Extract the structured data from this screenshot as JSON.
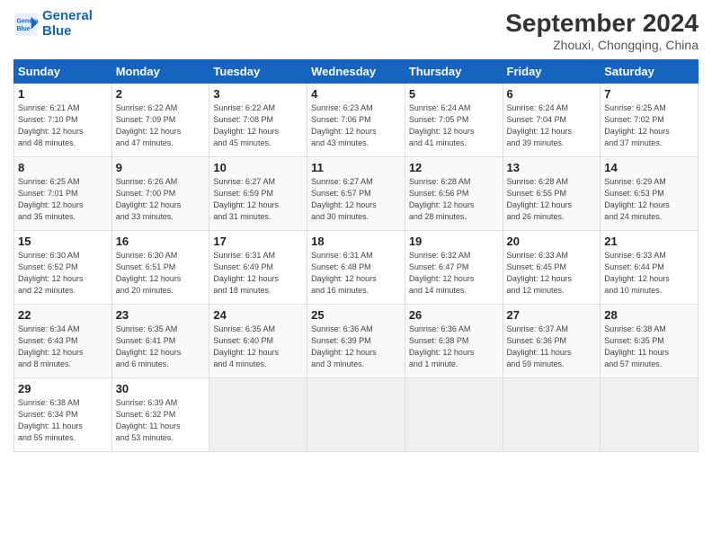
{
  "header": {
    "logo_line1": "General",
    "logo_line2": "Blue",
    "month_title": "September 2024",
    "location": "Zhouxi, Chongqing, China"
  },
  "weekdays": [
    "Sunday",
    "Monday",
    "Tuesday",
    "Wednesday",
    "Thursday",
    "Friday",
    "Saturday"
  ],
  "weeks": [
    [
      {
        "day": "1",
        "info": "Sunrise: 6:21 AM\nSunset: 7:10 PM\nDaylight: 12 hours\nand 48 minutes."
      },
      {
        "day": "2",
        "info": "Sunrise: 6:22 AM\nSunset: 7:09 PM\nDaylight: 12 hours\nand 47 minutes."
      },
      {
        "day": "3",
        "info": "Sunrise: 6:22 AM\nSunset: 7:08 PM\nDaylight: 12 hours\nand 45 minutes."
      },
      {
        "day": "4",
        "info": "Sunrise: 6:23 AM\nSunset: 7:06 PM\nDaylight: 12 hours\nand 43 minutes."
      },
      {
        "day": "5",
        "info": "Sunrise: 6:24 AM\nSunset: 7:05 PM\nDaylight: 12 hours\nand 41 minutes."
      },
      {
        "day": "6",
        "info": "Sunrise: 6:24 AM\nSunset: 7:04 PM\nDaylight: 12 hours\nand 39 minutes."
      },
      {
        "day": "7",
        "info": "Sunrise: 6:25 AM\nSunset: 7:02 PM\nDaylight: 12 hours\nand 37 minutes."
      }
    ],
    [
      {
        "day": "8",
        "info": "Sunrise: 6:25 AM\nSunset: 7:01 PM\nDaylight: 12 hours\nand 35 minutes."
      },
      {
        "day": "9",
        "info": "Sunrise: 6:26 AM\nSunset: 7:00 PM\nDaylight: 12 hours\nand 33 minutes."
      },
      {
        "day": "10",
        "info": "Sunrise: 6:27 AM\nSunset: 6:59 PM\nDaylight: 12 hours\nand 31 minutes."
      },
      {
        "day": "11",
        "info": "Sunrise: 6:27 AM\nSunset: 6:57 PM\nDaylight: 12 hours\nand 30 minutes."
      },
      {
        "day": "12",
        "info": "Sunrise: 6:28 AM\nSunset: 6:56 PM\nDaylight: 12 hours\nand 28 minutes."
      },
      {
        "day": "13",
        "info": "Sunrise: 6:28 AM\nSunset: 6:55 PM\nDaylight: 12 hours\nand 26 minutes."
      },
      {
        "day": "14",
        "info": "Sunrise: 6:29 AM\nSunset: 6:53 PM\nDaylight: 12 hours\nand 24 minutes."
      }
    ],
    [
      {
        "day": "15",
        "info": "Sunrise: 6:30 AM\nSunset: 6:52 PM\nDaylight: 12 hours\nand 22 minutes."
      },
      {
        "day": "16",
        "info": "Sunrise: 6:30 AM\nSunset: 6:51 PM\nDaylight: 12 hours\nand 20 minutes."
      },
      {
        "day": "17",
        "info": "Sunrise: 6:31 AM\nSunset: 6:49 PM\nDaylight: 12 hours\nand 18 minutes."
      },
      {
        "day": "18",
        "info": "Sunrise: 6:31 AM\nSunset: 6:48 PM\nDaylight: 12 hours\nand 16 minutes."
      },
      {
        "day": "19",
        "info": "Sunrise: 6:32 AM\nSunset: 6:47 PM\nDaylight: 12 hours\nand 14 minutes."
      },
      {
        "day": "20",
        "info": "Sunrise: 6:33 AM\nSunset: 6:45 PM\nDaylight: 12 hours\nand 12 minutes."
      },
      {
        "day": "21",
        "info": "Sunrise: 6:33 AM\nSunset: 6:44 PM\nDaylight: 12 hours\nand 10 minutes."
      }
    ],
    [
      {
        "day": "22",
        "info": "Sunrise: 6:34 AM\nSunset: 6:43 PM\nDaylight: 12 hours\nand 8 minutes."
      },
      {
        "day": "23",
        "info": "Sunrise: 6:35 AM\nSunset: 6:41 PM\nDaylight: 12 hours\nand 6 minutes."
      },
      {
        "day": "24",
        "info": "Sunrise: 6:35 AM\nSunset: 6:40 PM\nDaylight: 12 hours\nand 4 minutes."
      },
      {
        "day": "25",
        "info": "Sunrise: 6:36 AM\nSunset: 6:39 PM\nDaylight: 12 hours\nand 3 minutes."
      },
      {
        "day": "26",
        "info": "Sunrise: 6:36 AM\nSunset: 6:38 PM\nDaylight: 12 hours\nand 1 minute."
      },
      {
        "day": "27",
        "info": "Sunrise: 6:37 AM\nSunset: 6:36 PM\nDaylight: 11 hours\nand 59 minutes."
      },
      {
        "day": "28",
        "info": "Sunrise: 6:38 AM\nSunset: 6:35 PM\nDaylight: 11 hours\nand 57 minutes."
      }
    ],
    [
      {
        "day": "29",
        "info": "Sunrise: 6:38 AM\nSunset: 6:34 PM\nDaylight: 11 hours\nand 55 minutes."
      },
      {
        "day": "30",
        "info": "Sunrise: 6:39 AM\nSunset: 6:32 PM\nDaylight: 11 hours\nand 53 minutes."
      },
      {
        "day": "",
        "info": ""
      },
      {
        "day": "",
        "info": ""
      },
      {
        "day": "",
        "info": ""
      },
      {
        "day": "",
        "info": ""
      },
      {
        "day": "",
        "info": ""
      }
    ]
  ]
}
